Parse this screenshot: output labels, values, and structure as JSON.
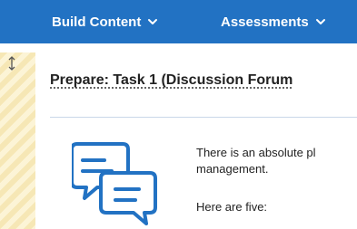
{
  "toolbar": {
    "build_content_label": "Build Content",
    "assessments_label": "Assessments",
    "background_color": "#2272c3",
    "menu_icon": "chevron-down-icon"
  },
  "content_item": {
    "title": "Prepare: Task 1 (Discussion Forum",
    "description_line_1": "There is an absolute pl",
    "description_line_2": "management.",
    "description_line_3": "Here are five:",
    "icon": "discussion-forum-icon",
    "icon_color": "#2272c3",
    "drag_handle_icon": "vertical-drag-arrow-icon"
  }
}
